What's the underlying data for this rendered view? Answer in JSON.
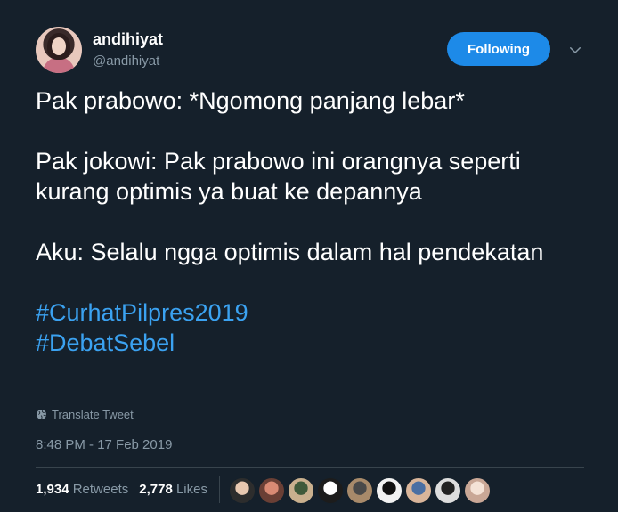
{
  "user": {
    "display_name": "andihiyat",
    "handle": "@andihiyat"
  },
  "header": {
    "follow_label": "Following"
  },
  "tweet": {
    "paragraphs": [
      "Pak prabowo: *Ngomong panjang lebar*",
      "Pak jokowi: Pak prabowo ini orangnya seperti kurang optimis ya buat ke depannya",
      "Aku: Selalu ngga optimis dalam hal pendekatan"
    ],
    "hashtags": [
      "#CurhatPilpres2019",
      "#DebatSebel"
    ]
  },
  "translate_label": "Translate Tweet",
  "timestamp": "8:48 PM - 17 Feb 2019",
  "stats": {
    "retweets_count": "1,934",
    "retweets_label": "Retweets",
    "likes_count": "2,778",
    "likes_label": "Likes"
  },
  "likers": [
    {
      "colors": [
        "#e9c8b0",
        "#2d2d2d"
      ]
    },
    {
      "colors": [
        "#d98a74",
        "#6a3f35"
      ]
    },
    {
      "colors": [
        "#3f5a3a",
        "#c9b08e"
      ]
    },
    {
      "colors": [
        "#ffffff",
        "#1c1c1c"
      ]
    },
    {
      "colors": [
        "#4a4a4a",
        "#a88a6a"
      ]
    },
    {
      "colors": [
        "#111111",
        "#f2f2f2"
      ]
    },
    {
      "colors": [
        "#4b6fa3",
        "#d9b59a"
      ]
    },
    {
      "colors": [
        "#222222",
        "#dddddd"
      ]
    },
    {
      "colors": [
        "#f4e2d6",
        "#c9a796"
      ]
    }
  ],
  "colors": {
    "background": "#15202b",
    "accent": "#1d8ae8",
    "hashtag": "#3ba2f1",
    "muted": "#8899a6"
  },
  "icons": {
    "chevron": "chevron-down-icon",
    "globe": "globe-icon"
  }
}
